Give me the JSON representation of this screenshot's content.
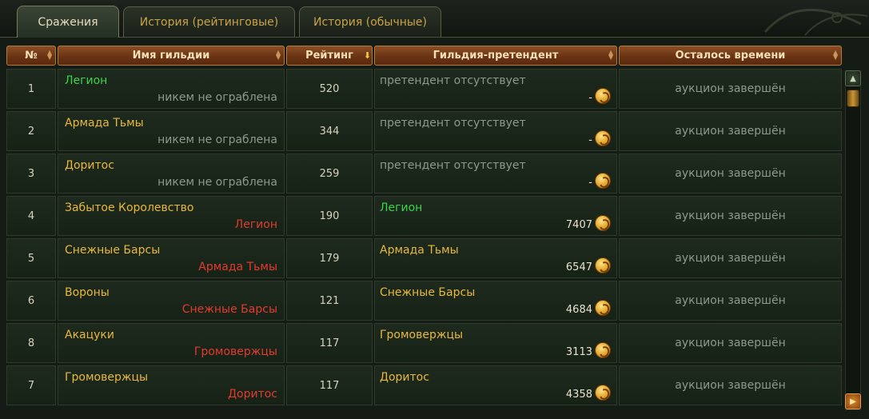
{
  "tabs": [
    {
      "label": "Сражения",
      "active": true
    },
    {
      "label": "История (рейтинговые)",
      "active": false
    },
    {
      "label": "История (обычные)",
      "active": false
    }
  ],
  "columns": {
    "num": "№",
    "guild": "Имя гильдии",
    "rating": "Рейтинг",
    "challenger": "Гильдия-претендент",
    "time_left": "Осталось времени"
  },
  "sorted_column": "rating",
  "colors": {
    "green": "#3fd24a",
    "gold": "#e8b740",
    "red": "#e33a2e",
    "grey": "#8c9a8c",
    "header": "#6a3414"
  },
  "rows": [
    {
      "num": "1",
      "guild": "Легион",
      "guild_color": "green",
      "robbed": "никем не ограблена",
      "robbed_color": "grey",
      "rating": "520",
      "challenger": "претендент отсутствует",
      "challenger_color": "grey",
      "bid": "-",
      "time": "аукцион завершён"
    },
    {
      "num": "2",
      "guild": "Армада Тьмы",
      "guild_color": "gold",
      "robbed": "никем не ограблена",
      "robbed_color": "grey",
      "rating": "344",
      "challenger": "претендент отсутствует",
      "challenger_color": "grey",
      "bid": "-",
      "time": "аукцион завершён"
    },
    {
      "num": "3",
      "guild": "Доритос",
      "guild_color": "gold",
      "robbed": "никем не ограблена",
      "robbed_color": "grey",
      "rating": "259",
      "challenger": "претендент отсутствует",
      "challenger_color": "grey",
      "bid": "-",
      "time": "аукцион завершён"
    },
    {
      "num": "4",
      "guild": "Забытое Королевство",
      "guild_color": "gold",
      "robbed": "Легион",
      "robbed_color": "red",
      "rating": "190",
      "challenger": "Легион",
      "challenger_color": "green",
      "bid": "7407",
      "time": "аукцион завершён"
    },
    {
      "num": "5",
      "guild": "Снежные Барсы",
      "guild_color": "gold",
      "robbed": "Армада Тьмы",
      "robbed_color": "red",
      "rating": "179",
      "challenger": "Армада Тьмы",
      "challenger_color": "gold",
      "bid": "6547",
      "time": "аукцион завершён"
    },
    {
      "num": "6",
      "guild": "Вороны",
      "guild_color": "gold",
      "robbed": "Снежные Барсы",
      "robbed_color": "red",
      "rating": "121",
      "challenger": "Снежные Барсы",
      "challenger_color": "gold",
      "bid": "4684",
      "time": "аукцион завершён"
    },
    {
      "num": "8",
      "guild": "Акацуки",
      "guild_color": "gold",
      "robbed": "Громовержцы",
      "robbed_color": "red",
      "rating": "117",
      "challenger": "Громовержцы",
      "challenger_color": "gold",
      "bid": "3113",
      "time": "аукцион завершён"
    },
    {
      "num": "7",
      "guild": "Громовержцы",
      "guild_color": "gold",
      "robbed": "Доритос",
      "robbed_color": "red",
      "rating": "117",
      "challenger": "Доритос",
      "challenger_color": "gold",
      "bid": "4358",
      "time": "аукцион завершён"
    }
  ]
}
